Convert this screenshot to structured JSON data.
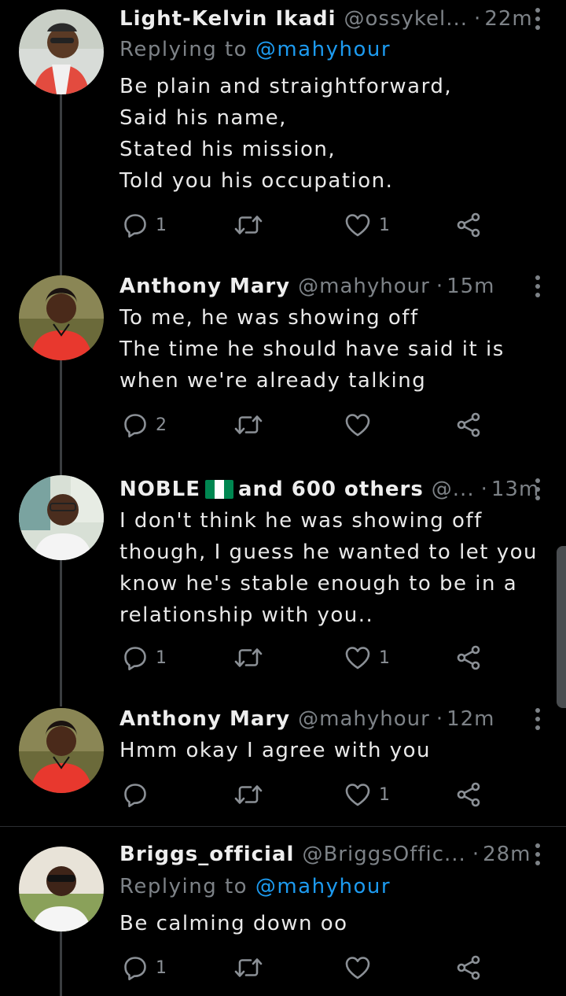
{
  "tweets": [
    {
      "name": "Light-Kelvin Ikadi",
      "handle": "@ossykel...",
      "time": "22m",
      "replying_prefix": "Replying to",
      "replying_to": "@mahyhour",
      "body": "Be plain and straightforward,\nSaid his name,\nStated his mission,\nTold you his occupation.",
      "replies": "1",
      "retweets": "",
      "likes": "1"
    },
    {
      "name": "Anthony Mary",
      "handle": "@mahyhour",
      "time": "15m",
      "body": "To me, he was showing off\nThe time he should have said it is when we're already talking",
      "replies": "2",
      "retweets": "",
      "likes": ""
    },
    {
      "name": "NOBLE",
      "name_suffix": "and 600 others",
      "handle": "@...",
      "time": "13m",
      "body": "I don't think he was showing off though, I guess he wanted to let you know he's stable enough to be in a relationship with you..",
      "replies": "1",
      "retweets": "",
      "likes": "1"
    },
    {
      "name": "Anthony Mary",
      "handle": "@mahyhour",
      "time": "12m",
      "body": "Hmm okay I agree with you",
      "replies": "",
      "retweets": "",
      "likes": "1"
    },
    {
      "name": "Briggs_official",
      "handle": "@BriggsOffic...",
      "time": "28m",
      "replying_prefix": "Replying to",
      "replying_to": "@mahyhour",
      "body": "Be calming down oo",
      "replies": "1",
      "retweets": "",
      "likes": ""
    }
  ],
  "colors": {
    "background": "#000000",
    "muted": "#7d8287",
    "mention": "#1d9bf0",
    "thread_line": "#3a3d40",
    "nigeria_green": "#008751"
  },
  "icons": [
    "reply-icon",
    "retweet-icon",
    "like-icon",
    "share-icon",
    "more-icon",
    "nigeria-flag-icon"
  ]
}
